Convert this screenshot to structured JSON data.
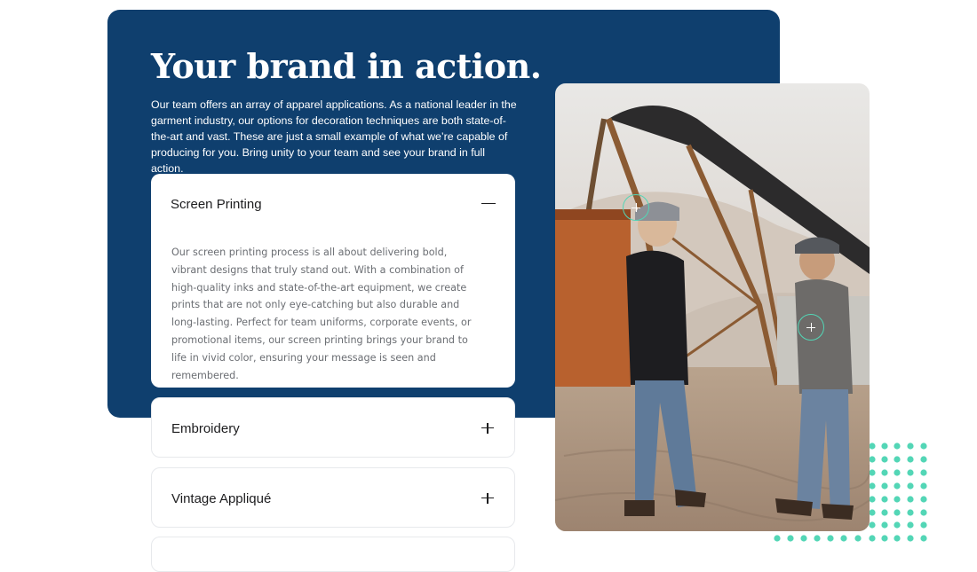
{
  "hero": {
    "title": "Your brand in action.",
    "intro": "Our team offers an array of apparel applications. As a national leader in the garment industry, our options for decoration techniques are both state-of-the-art and vast. These are just a small example of what we’re capable of producing for you. Bring unity to your team and see your brand in full action."
  },
  "accordion": {
    "items": [
      {
        "title": "Screen Printing",
        "expanded": true,
        "body": "Our screen printing process is all about delivering bold, vibrant designs that truly stand out. With a combination of high-quality inks and state-of-the-art equipment, we create prints that are not only eye-catching but also durable and long-lasting. Perfect for team uniforms, corporate events, or promotional items, our screen printing brings your brand to life in vivid color, ensuring your message is seen and remembered."
      },
      {
        "title": "Embroidery",
        "expanded": false
      },
      {
        "title": "Vintage Appliqué",
        "expanded": false
      },
      {
        "title": "",
        "expanded": false
      }
    ]
  },
  "photo": {
    "icons": [
      "plus-hotspot-icon",
      "plus-hotspot-icon"
    ]
  },
  "colors": {
    "panel": "#0f3f6e",
    "accent": "#53d6b6",
    "body_text": "#6b6e73"
  }
}
